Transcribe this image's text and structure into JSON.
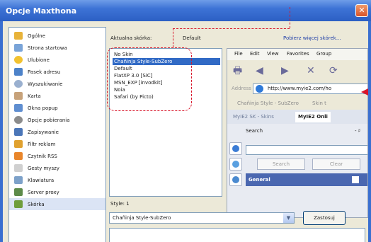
{
  "window": {
    "title": "Opcje Maxthona",
    "close_glyph": "✕"
  },
  "categories": [
    {
      "label": "Ogólne",
      "icon": "general-icon",
      "color": "#e8b33a"
    },
    {
      "label": "Strona startowa",
      "icon": "home-icon",
      "color": "#7aa4d8"
    },
    {
      "label": "Ulubione",
      "icon": "star-icon",
      "color": "#f2c230"
    },
    {
      "label": "Pasek adresu",
      "icon": "address-bar-icon",
      "color": "#4d82c9"
    },
    {
      "label": "Wyszukiwanie",
      "icon": "search-icon",
      "color": "#9ab0cf"
    },
    {
      "label": "Karta",
      "icon": "tab-icon",
      "color": "#c7a27a"
    },
    {
      "label": "Okna popup",
      "icon": "popup-icon",
      "color": "#5f8ed0"
    },
    {
      "label": "Opcje pobierania",
      "icon": "gear-icon",
      "color": "#8c8c8c"
    },
    {
      "label": "Zapisywanie",
      "icon": "save-icon",
      "color": "#4b76b8"
    },
    {
      "label": "Filtr reklam",
      "icon": "filter-icon",
      "color": "#e0a12f"
    },
    {
      "label": "Czytnik RSS",
      "icon": "rss-icon",
      "color": "#e9862b"
    },
    {
      "label": "Gesty myszy",
      "icon": "mouse-icon",
      "color": "#d0d0d0"
    },
    {
      "label": "Klawiatura",
      "icon": "keyboard-icon",
      "color": "#7da1c9"
    },
    {
      "label": "Server proxy",
      "icon": "proxy-icon",
      "color": "#5d8b4a"
    },
    {
      "label": "Skórka",
      "icon": "skin-icon",
      "color": "#6f9d3c"
    }
  ],
  "skins": {
    "current_label": "Aktualna skórka:",
    "current_value": "Default",
    "download_link": "Pobierz więcej skórek...",
    "list": [
      "No Skin",
      "Chañinja Style-SubZero",
      "Default",
      "FlatXP 3.0 [SiC]",
      "MSN_EXP [invodkit]",
      "Noia",
      "Safari (by Picto)"
    ],
    "selected_index": 1
  },
  "preview": {
    "menu": [
      "File",
      "Edit",
      "View",
      "Favorites",
      "Group"
    ],
    "address_label": "Address",
    "address_value": "http://www.myie2.com/ho",
    "links": [
      "Chañinja Style - SubZero",
      "Skin t"
    ],
    "tabs": [
      "MyIE2 SK - Skins",
      "MyIE2 Onli"
    ],
    "search_label": "Search",
    "search_pin": "- ♯",
    "search_button": "Search",
    "clear_button": "Clear",
    "group_label": "General"
  },
  "style": {
    "label": "Style: 1",
    "value": "Chañinja Style-SubZero",
    "apply_label": "Zastosuj"
  }
}
